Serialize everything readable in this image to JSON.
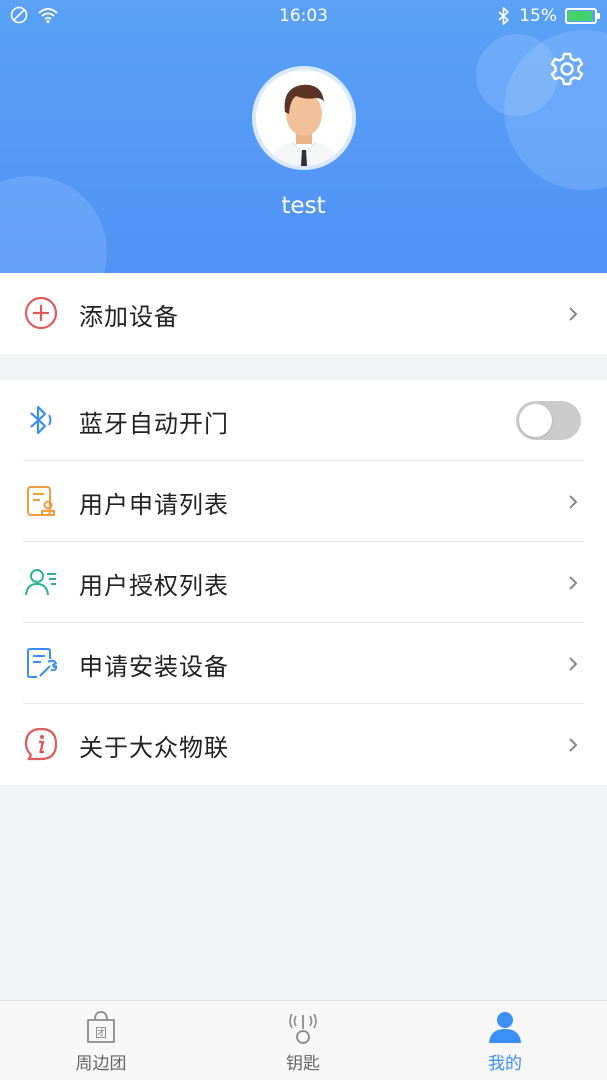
{
  "status_bar": {
    "time": "16:03",
    "battery_percent": "15%",
    "icons": [
      "no-sim-icon",
      "wifi-icon",
      "bluetooth-icon",
      "battery-icon"
    ]
  },
  "header": {
    "username": "test",
    "gradient_colors": [
      "#5aa1f7",
      "#4f93f5"
    ],
    "settings_icon": "gear-icon",
    "avatar_icon": "user-avatar"
  },
  "menu": {
    "add_device": {
      "label": "添加设备",
      "icon": "plus-circle-icon",
      "color": "#e05a5a"
    },
    "items": [
      {
        "label": "蓝牙自动开门",
        "icon": "bluetooth-icon",
        "color": "#3a8ef6",
        "toggle": false
      },
      {
        "label": "用户申请列表",
        "icon": "application-list-icon",
        "color": "#f39c3c"
      },
      {
        "label": "用户授权列表",
        "icon": "user-authorization-icon",
        "color": "#2bb58c"
      },
      {
        "label": "申请安装设备",
        "icon": "install-device-icon",
        "color": "#3a8ef6"
      },
      {
        "label": "关于大众物联",
        "icon": "info-icon",
        "color": "#e05a5a"
      }
    ]
  },
  "tabbar": {
    "tabs": [
      {
        "label": "周边团",
        "icon": "group-bag-icon",
        "active": false
      },
      {
        "label": "钥匙",
        "icon": "key-signal-icon",
        "active": false
      },
      {
        "label": "我的",
        "icon": "profile-icon",
        "active": true
      }
    ],
    "active_color": "#3a8ef6"
  }
}
